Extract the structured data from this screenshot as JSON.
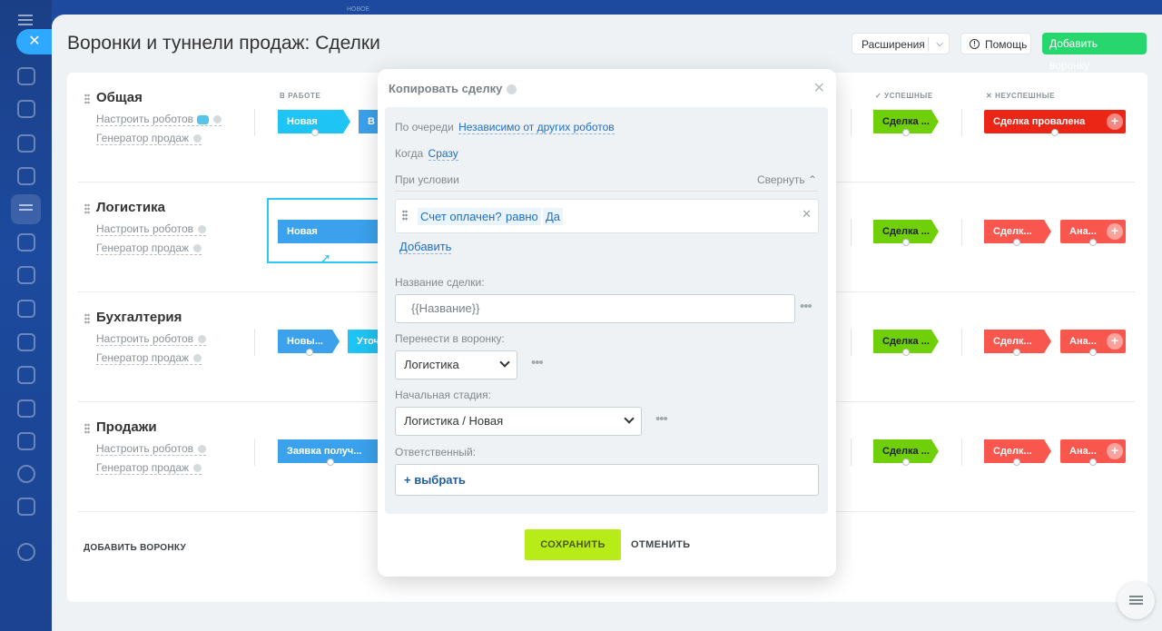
{
  "top_hint": "НОВОЕ",
  "page": {
    "title": "Воронки и туннели продаж: Сделки"
  },
  "toolbar": {
    "extensions": "Расширения",
    "help": "Помощь",
    "add_funnel": "Добавить воронку"
  },
  "columns": {
    "in_work": "В РАБОТЕ",
    "success": "✓ УСПЕШНЫЕ",
    "fail": "✕ НЕУСПЕШНЫЕ"
  },
  "funnels": [
    {
      "name": "Общая",
      "robots": "Настроить роботов",
      "generator": "Генератор продаж",
      "stages": [
        "Новая",
        "В"
      ],
      "success": "Сделка ...",
      "fail": [
        "Сделка провалена"
      ]
    },
    {
      "name": "Логистика",
      "robots": "Настроить роботов",
      "generator": "Генератор продаж",
      "stages": [
        "Новая"
      ],
      "success": "Сделка ...",
      "fail": [
        "Сделк...",
        "Ана..."
      ]
    },
    {
      "name": "Бухгалтерия",
      "robots": "Настроить роботов",
      "generator": "Генератор продаж",
      "stages": [
        "Новы...",
        "Уточ"
      ],
      "success": "Сделка ...",
      "fail": [
        "Сделк...",
        "Ана..."
      ]
    },
    {
      "name": "Продажи",
      "robots": "Настроить роботов",
      "generator": "Генератор продаж",
      "stages": [
        "Заявка получ..."
      ],
      "success": "Сделка ...",
      "fail": [
        "Сделк...",
        "Ана..."
      ]
    }
  ],
  "add_funnel_bottom": "ДОБАВИТЬ ВОРОНКУ",
  "modal": {
    "title": "Копировать сделку",
    "order_label": "По очереди",
    "order_value": "Независимо от других роботов",
    "when_label": "Когда",
    "when_value": "Сразу",
    "condition_label": "При условии",
    "collapse": "Свернуть",
    "condition": {
      "field": "Счет оплачен?",
      "op": "равно",
      "value": "Да"
    },
    "add": "Добавить",
    "deal_name_label": "Название сделки:",
    "deal_name_value": "{{Название}}",
    "move_label": "Перенести в воронку:",
    "move_value": "Логистика",
    "stage_label": "Начальная стадия:",
    "stage_value": "Логистика / Новая",
    "responsible_label": "Ответственный:",
    "choose": "+ выбрать",
    "save": "СОХРАНИТЬ",
    "cancel": "ОТМЕНИТЬ"
  }
}
